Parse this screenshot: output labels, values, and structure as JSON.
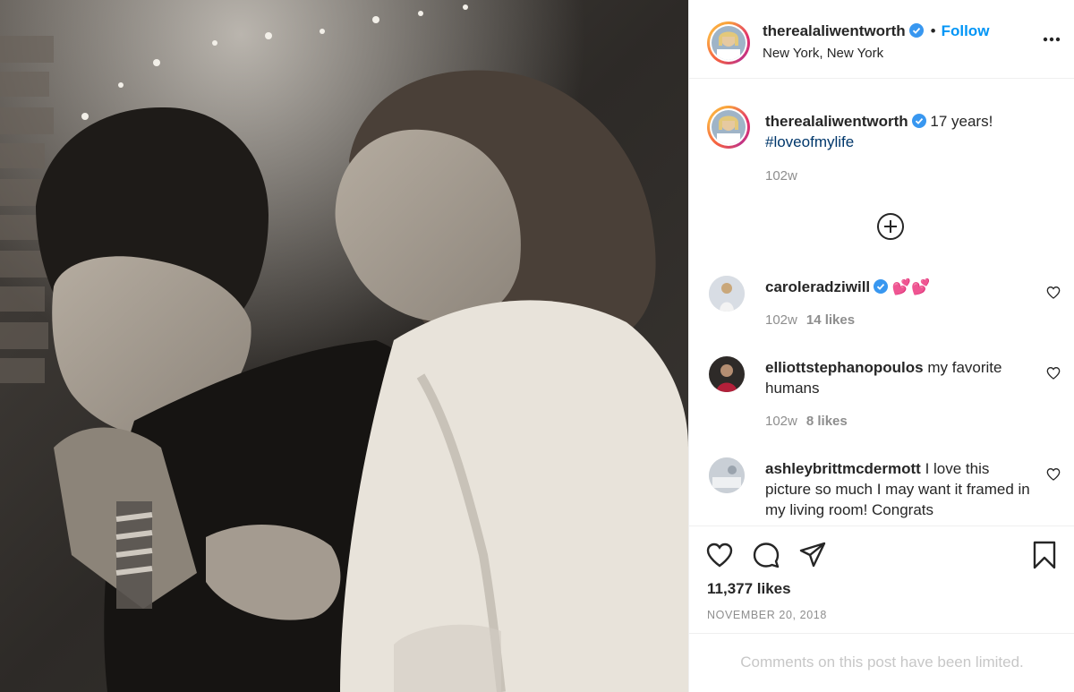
{
  "post": {
    "author": "therealaliwentworth",
    "follow_label": "Follow",
    "dot": "•",
    "location": "New York, New York",
    "photo_icon": "photo-image"
  },
  "caption": {
    "author": "therealaliwentworth",
    "text": "17 years!",
    "hashtag": "#loveofmylife",
    "time": "102w"
  },
  "comments": [
    {
      "author": "caroleradziwill",
      "verified": true,
      "text": "💕💕",
      "time": "102w",
      "likes": "14 likes"
    },
    {
      "author": "elliottstephanopoulos",
      "verified": false,
      "text": "my favorite humans",
      "time": "102w",
      "likes": "8 likes"
    },
    {
      "author": "ashleybrittmcdermott",
      "verified": false,
      "text": "I love this picture so much I may want it framed in my living room! Congrats",
      "time": "",
      "likes": ""
    }
  ],
  "actions": {
    "likes": "11,377 likes",
    "date": "NOVEMBER 20, 2018",
    "icons": [
      "heart-icon",
      "comment-icon",
      "share-icon",
      "bookmark-icon"
    ]
  },
  "footer": {
    "limited_text": "Comments on this post have been limited."
  },
  "colors": {
    "accent": "#0095f6",
    "verified": "#3897f0",
    "muted": "#8e8e8e",
    "hashtag": "#00376b"
  }
}
